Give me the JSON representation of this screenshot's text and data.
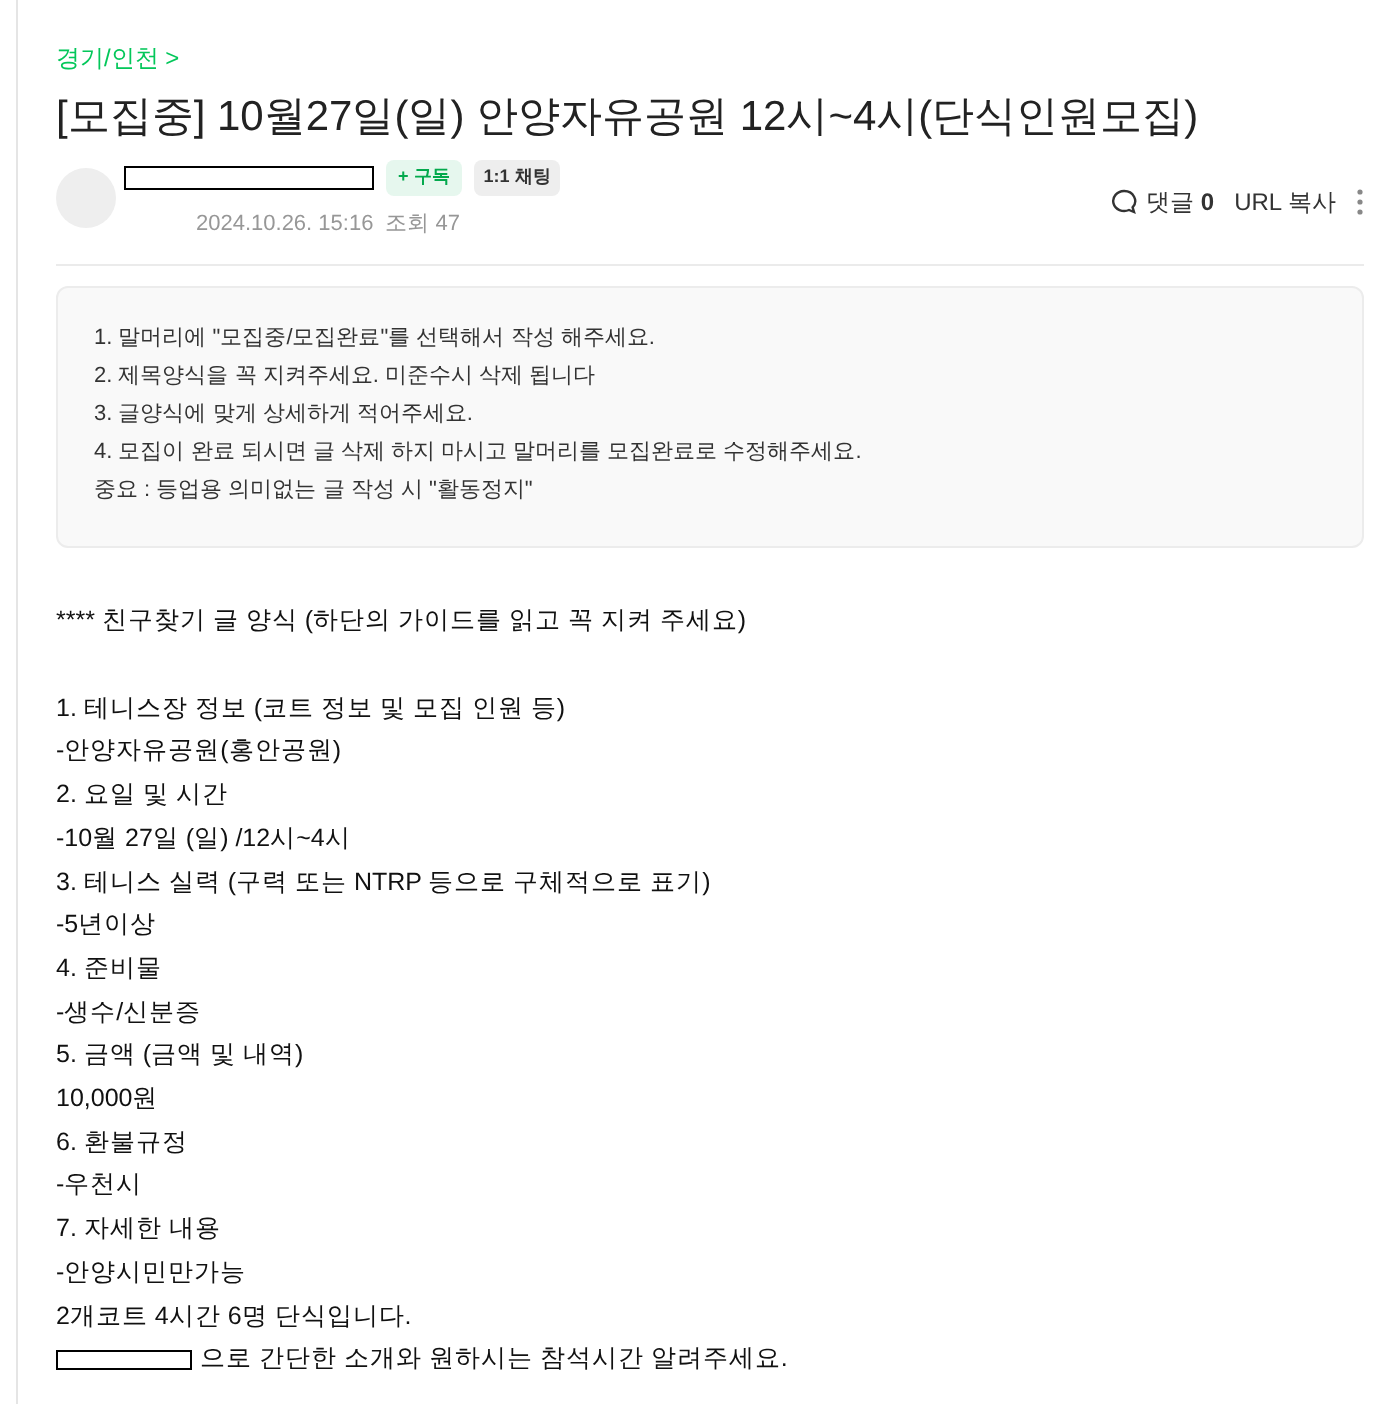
{
  "breadcrumb": "경기/인천 >",
  "title": "[모집중] 10월27일(일) 안양자유공원 12시~4시(단식인원모집)",
  "author": {
    "subscribe": "+ 구독",
    "chat": "1:1 채팅",
    "date": "2024.10.26. 15:16",
    "views": "조회 47"
  },
  "actions": {
    "comments_label": "댓글",
    "comments_count": "0",
    "url_copy": "URL 복사"
  },
  "guide": [
    "1. 말머리에 \"모집중/모집완료\"를 선택해서 작성 해주세요.",
    "2. 제목양식을 꼭 지켜주세요. 미준수시 삭제 됩니다",
    "3. 글양식에 맞게 상세하게 적어주세요.",
    "4. 모집이 완료 되시면 글 삭제 하지 마시고 말머리를 모집완료로 수정해주세요.",
    "중요 : 등업용 의미없는 글 작성 시 \"활동정지\""
  ],
  "body": {
    "intro": "**** 친구찾기 글 양식 (하단의 가이드를 읽고 꼭 지켜 주세요)",
    "lines": [
      "1. 테니스장 정보 (코트 정보 및 모집 인원 등)",
      "-안양자유공원(홍안공원)",
      "2. 요일 및 시간",
      "-10월 27일 (일) /12시~4시",
      "3. 테니스 실력 (구력 또는 NTRP 등으로 구체적으로 표기)",
      "-5년이상",
      "4. 준비물",
      "-생수/신분증",
      "5. 금액 (금액 및 내역)",
      "10,000원",
      "6. 환불규정",
      "-우천시",
      "7. 자세한 내용",
      "-안양시민만가능",
      "2개코트 4시간 6명 단식입니다."
    ],
    "closing": "으로 간단한 소개와 원하시는 참석시간 알려주세요."
  }
}
